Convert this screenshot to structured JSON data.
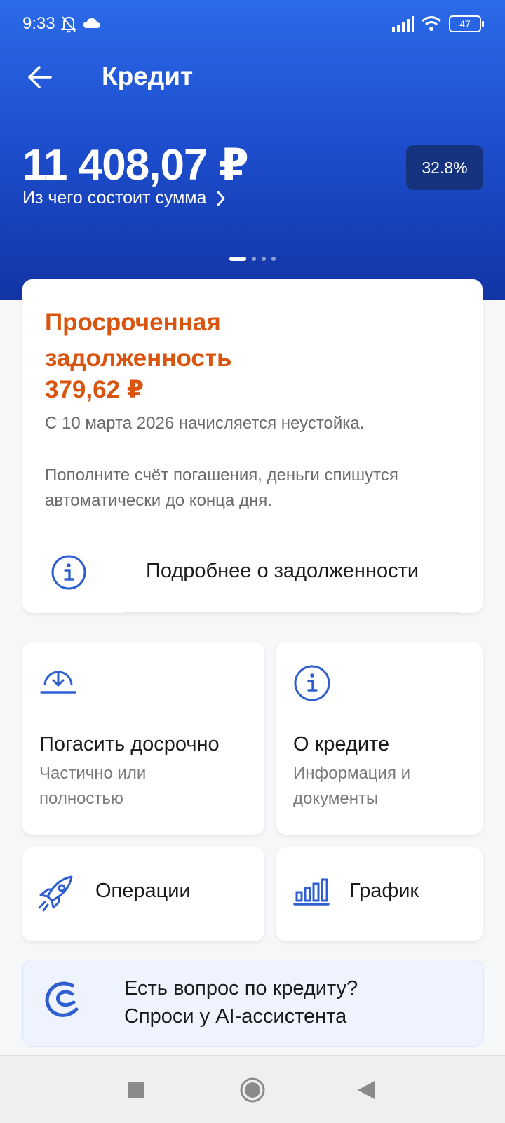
{
  "status_bar": {
    "time": "9:33",
    "battery": "47"
  },
  "header": {
    "title": "Кредит",
    "amount": "11 408,07 ₽",
    "breakdown_link": "Из чего состоит сумма",
    "rate_badge": "32.8%"
  },
  "overdue": {
    "title": "Просроченная задолженность",
    "amount": "379,62 ₽",
    "penalty_note": "С 10 марта 2026 начисляется неустойка.",
    "instruction": "Пополните счёт погашения, деньги спишутся автоматически до конца дня.",
    "details_link": "Подробнее о задолженности"
  },
  "tiles": [
    {
      "title": "Погасить досрочно",
      "subtitle": "Частично или полностью"
    },
    {
      "title": "О кредите",
      "subtitle": "Информация и документы"
    },
    {
      "title": "Операции"
    },
    {
      "title": "График"
    }
  ],
  "ai_banner": {
    "line1": "Есть вопрос по кредиту?",
    "line2": "Спроси у AI-ассистента"
  },
  "colors": {
    "brand_blue": "#2b6ae8",
    "overdue_orange": "#d9540e",
    "icon_blue": "#2e5fd0"
  }
}
